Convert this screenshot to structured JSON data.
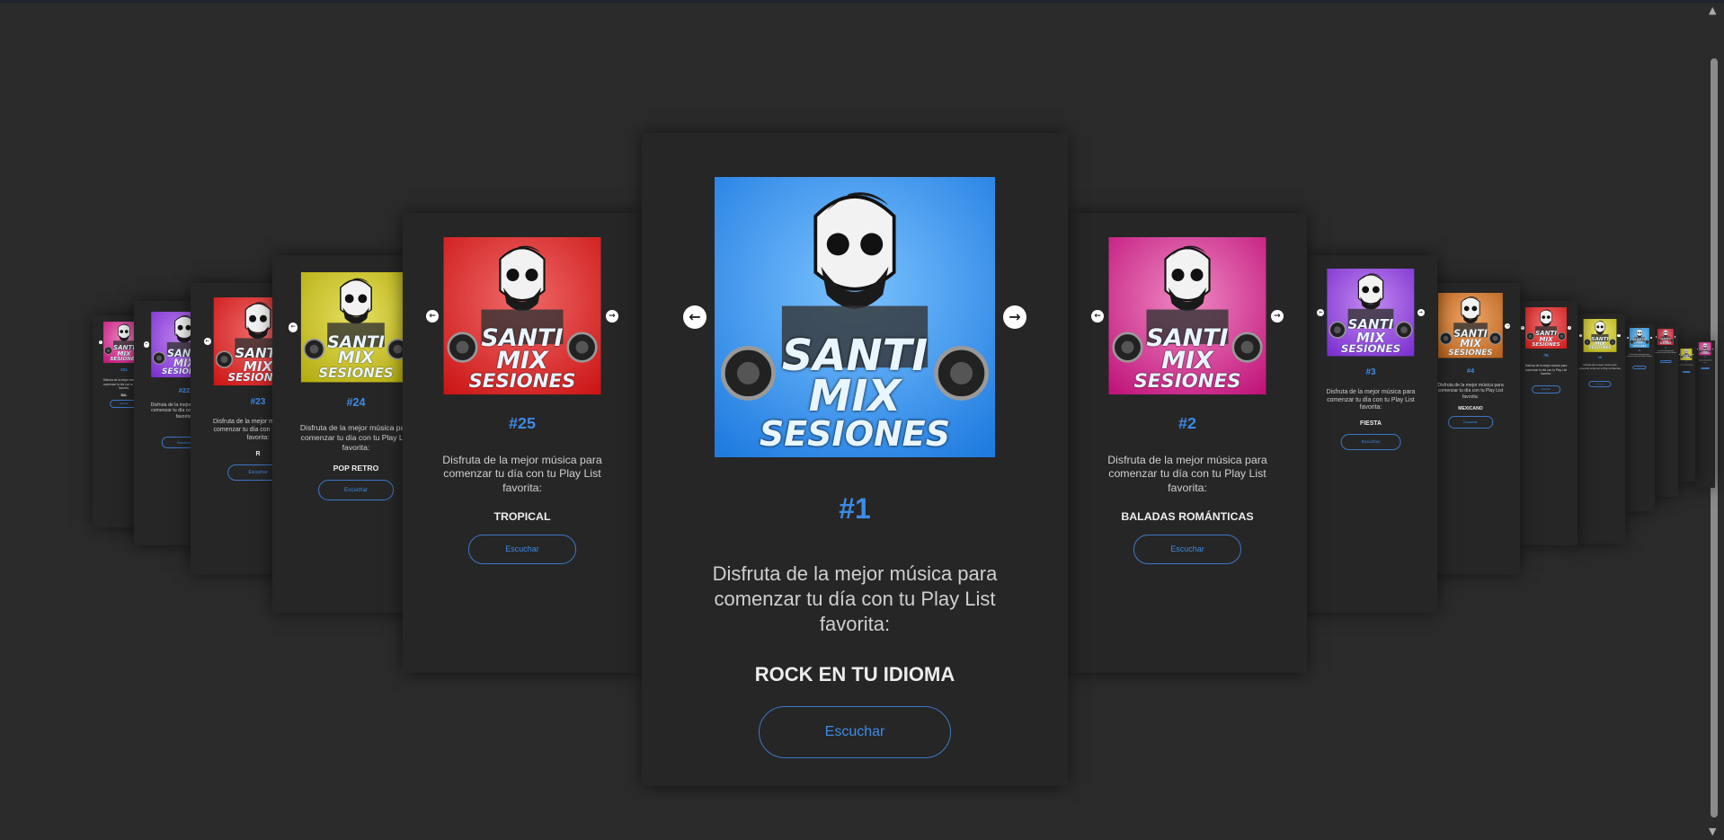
{
  "carousel": {
    "description": "Disfruta de la mejor música para comenzar tu día con tu Play List favorita:",
    "button_label": "Escuchar",
    "art_text": [
      "SANTI",
      "MIX",
      "SESIONES"
    ],
    "nav_prev_icon": "arrow-left-icon",
    "nav_next_icon": "arrow-right-icon",
    "cards": [
      {
        "num": "#1",
        "genre": "ROCK EN TU IDIOMA",
        "color": "#1f7be0",
        "color2": "#7cc3ff"
      },
      {
        "num": "#2",
        "genre": "BALADAS ROMÁNTICAS",
        "color": "#c0147a",
        "color2": "#f08ac4"
      },
      {
        "num": "#3",
        "genre": "FIESTA",
        "color": "#7a2fd0",
        "color2": "#c48af0"
      },
      {
        "num": "#4",
        "genre": "MEXICANO",
        "color": "#b8621a",
        "color2": "#f0a76a"
      },
      {
        "num": "#5",
        "genre": "",
        "color": "#d01c1c",
        "color2": "#f07070"
      },
      {
        "num": "#6",
        "genre": "",
        "color": "#b8b41a",
        "color2": "#e8e070"
      },
      {
        "num": "#7",
        "genre": "",
        "color": "#2a8fd8",
        "color2": "#8ccaf0"
      },
      {
        "num": "#8",
        "genre": "",
        "color": "#c01c2c",
        "color2": "#f07080"
      },
      {
        "num": "#9",
        "genre": "",
        "color": "#b8b41a",
        "color2": "#e8e070"
      },
      {
        "num": "#10",
        "genre": "",
        "color": "#c0147a",
        "color2": "#f08ac4"
      },
      {
        "num": "#25",
        "genre": "TROPICAL",
        "color": "#cc1616",
        "color2": "#f06a6a"
      },
      {
        "num": "#24",
        "genre": "POP RETRO",
        "color": "#b4ac10",
        "color2": "#e6e060"
      },
      {
        "num": "#23",
        "genre": "R",
        "color": "#cc1616",
        "color2": "#f06a6a"
      },
      {
        "num": "#22",
        "genre": "",
        "color": "#7a2fd0",
        "color2": "#c48af0"
      },
      {
        "num": "#21",
        "genre": "BAL",
        "color": "#c0147a",
        "color2": "#f08ac4"
      }
    ]
  }
}
